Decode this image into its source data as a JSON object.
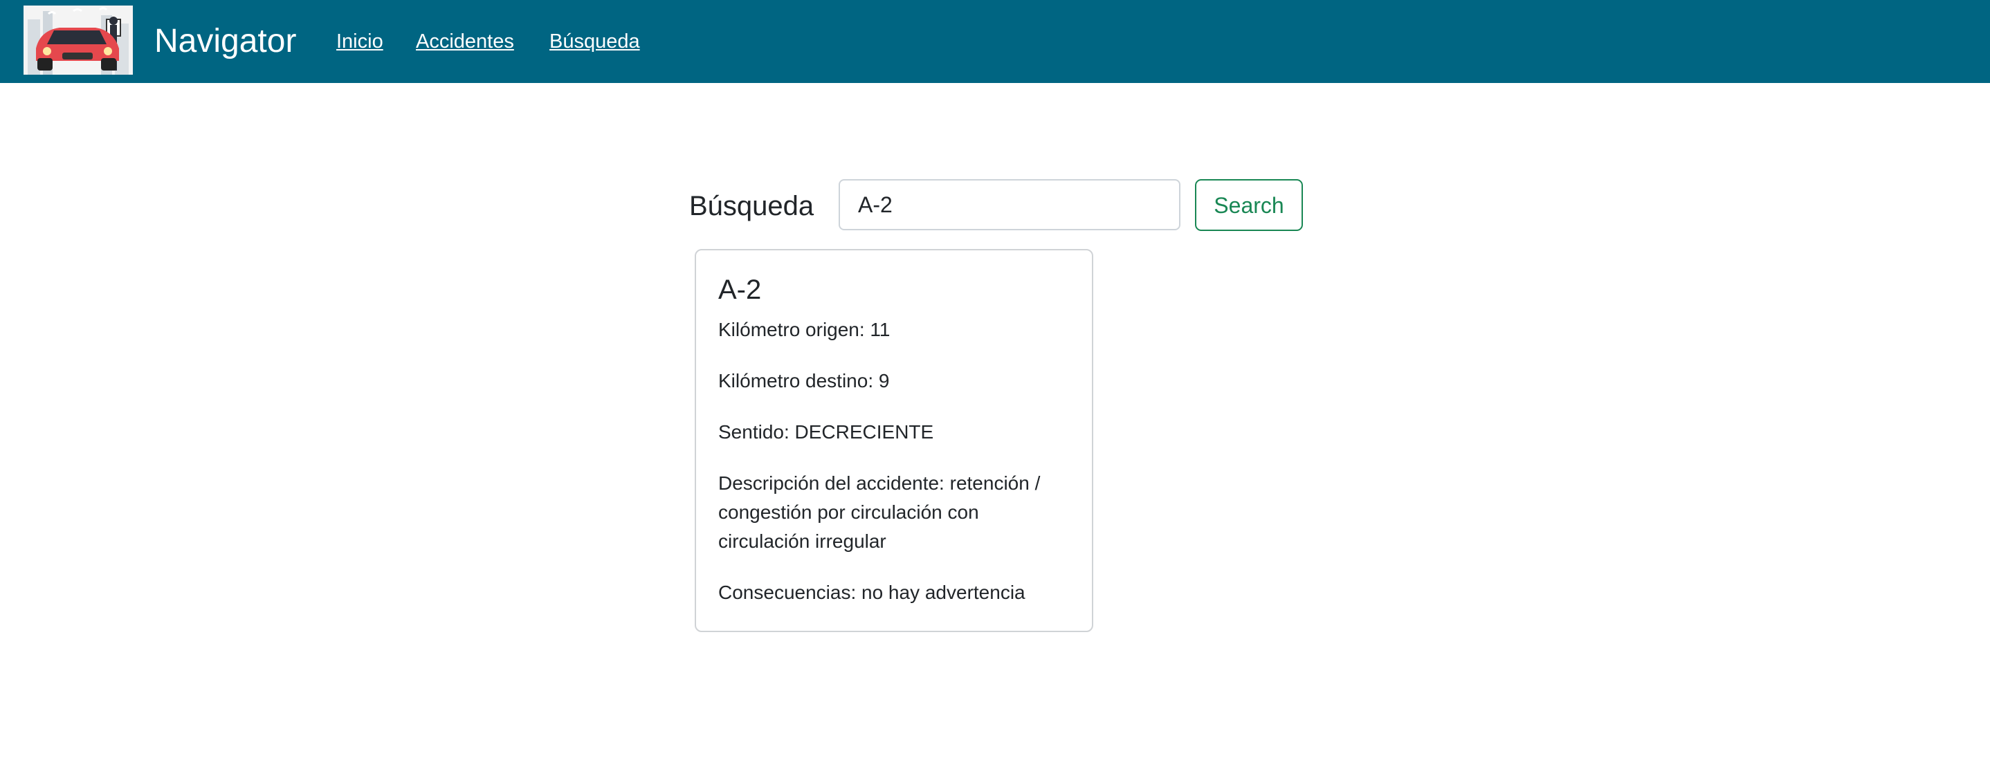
{
  "header": {
    "brand": "Navigator",
    "logo_icon": "car-logo-icon",
    "nav": [
      {
        "label": "Inicio"
      },
      {
        "label": "Accidentes"
      },
      {
        "label": "Búsqueda"
      }
    ],
    "colors": {
      "navbar_bg": "#006582",
      "nav_text": "#ffffff"
    }
  },
  "search": {
    "label": "Búsqueda",
    "value": "A-2",
    "button_label": "Search",
    "button_color": "#198754"
  },
  "result": {
    "title": "A-2",
    "km_origin": "Kilómetro origen: 11",
    "km_destination": "Kilómetro destino: 9",
    "direction": "Sentido: DECRECIENTE",
    "description": "Descripción del accidente: retención / congestión por circulación con circulación irregular",
    "consequences": "Consecuencias: no hay advertencia"
  }
}
